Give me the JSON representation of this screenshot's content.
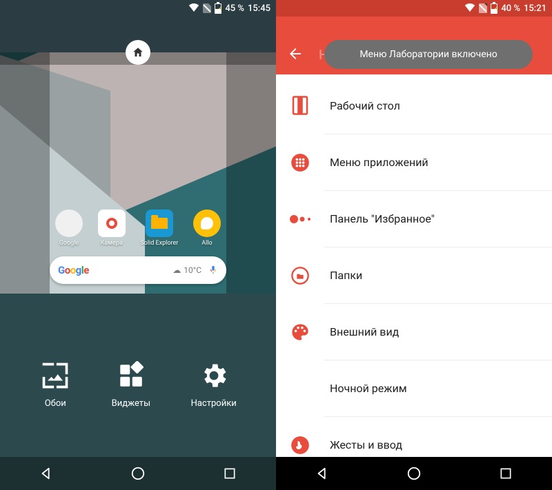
{
  "left": {
    "status": {
      "battery": "45 %",
      "time": "15:45"
    },
    "apps": [
      {
        "label": "Google",
        "id": "google-folder"
      },
      {
        "label": "Камера",
        "id": "camera"
      },
      {
        "label": "Solid Explorer",
        "id": "solid-explorer"
      },
      {
        "label": "Allo",
        "id": "allo"
      }
    ],
    "search": {
      "logo": "Google",
      "weather": "10°C"
    },
    "actions": [
      {
        "label": "Обои",
        "id": "wallpaper"
      },
      {
        "label": "Виджеты",
        "id": "widgets"
      },
      {
        "label": "Настройки",
        "id": "settings"
      }
    ]
  },
  "right": {
    "status": {
      "battery": "40 %",
      "time": "15:21"
    },
    "title_behind": "Настройки Nova",
    "toast": "Меню Лаборатории включено",
    "items": [
      {
        "label": "Рабочий стол",
        "icon": "desktop"
      },
      {
        "label": "Меню приложений",
        "icon": "app-drawer"
      },
      {
        "label": "Панель \"Избранное\"",
        "icon": "dock"
      },
      {
        "label": "Папки",
        "icon": "folders"
      },
      {
        "label": "Внешний вид",
        "icon": "appearance"
      },
      {
        "label": "Ночной режим",
        "icon": "night"
      },
      {
        "label": "Жесты и ввод",
        "icon": "gestures"
      }
    ]
  }
}
